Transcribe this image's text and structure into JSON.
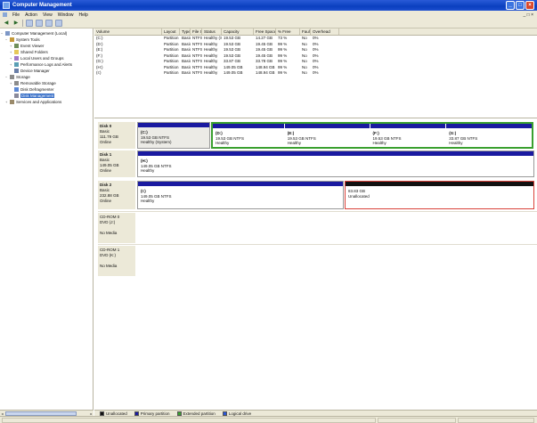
{
  "window": {
    "title": "Computer Management",
    "buttons": [
      "_",
      "□",
      "×"
    ]
  },
  "menubar": {
    "items": [
      "File",
      "Action",
      "View",
      "Window",
      "Help"
    ],
    "sys_label": "_ □ ×"
  },
  "toolbar": {
    "icons": [
      "back-icon",
      "forward-icon",
      "up-icon",
      "show-hide-tree-icon",
      "properties-icon",
      "help-icon"
    ]
  },
  "tree": {
    "items": [
      {
        "label": "Computer Management (Local)",
        "icon": "computer-icon",
        "depth": 0,
        "expander": "−"
      },
      {
        "label": "System Tools",
        "icon": "tools-icon",
        "depth": 1,
        "expander": "−"
      },
      {
        "label": "Event Viewer",
        "icon": "event-viewer-icon",
        "depth": 2,
        "expander": "+"
      },
      {
        "label": "Shared Folders",
        "icon": "folder-icon",
        "depth": 2,
        "expander": "+"
      },
      {
        "label": "Local Users and Groups",
        "icon": "users-icon",
        "depth": 2,
        "expander": "+"
      },
      {
        "label": "Performance Logs and Alerts",
        "icon": "performance-icon",
        "depth": 2,
        "expander": "+"
      },
      {
        "label": "Device Manager",
        "icon": "device-manager-icon",
        "depth": 2,
        "expander": ""
      },
      {
        "label": "Storage",
        "icon": "storage-icon",
        "depth": 1,
        "expander": "−"
      },
      {
        "label": "Removable Storage",
        "icon": "removable-storage-icon",
        "depth": 2,
        "expander": "+"
      },
      {
        "label": "Disk Defragmenter",
        "icon": "defrag-icon",
        "depth": 2,
        "expander": ""
      },
      {
        "label": "Disk Management",
        "icon": "disk-management-icon",
        "depth": 2,
        "expander": "",
        "selected": true
      },
      {
        "label": "Services and Applications",
        "icon": "services-icon",
        "depth": 1,
        "expander": "+"
      }
    ]
  },
  "volume_list": {
    "columns": [
      "Volume",
      "Layout",
      "Type",
      "File System",
      "Status",
      "Capacity",
      "Free Space",
      "% Free",
      "Fault Tolerance",
      "Overhead"
    ],
    "rows": [
      [
        "(C:)",
        "Partition",
        "Basic",
        "NTFS",
        "Healthy (System)",
        "19.53 GB",
        "14.27 GB",
        "73 %",
        "No",
        "0%"
      ],
      [
        "(D:)",
        "Partition",
        "Basic",
        "NTFS",
        "Healthy",
        "19.53 GB",
        "19.45 GB",
        "99 %",
        "No",
        "0%"
      ],
      [
        "(E:)",
        "Partition",
        "Basic",
        "NTFS",
        "Healthy",
        "19.53 GB",
        "19.45 GB",
        "99 %",
        "No",
        "0%"
      ],
      [
        "(F:)",
        "Partition",
        "Basic",
        "NTFS",
        "Healthy",
        "19.53 GB",
        "19.45 GB",
        "99 %",
        "No",
        "0%"
      ],
      [
        "(G:)",
        "Partition",
        "Basic",
        "NTFS",
        "Healthy",
        "33.87 GB",
        "33.78 GB",
        "99 %",
        "No",
        "0%"
      ],
      [
        "(H:)",
        "Partition",
        "Basic",
        "NTFS",
        "Healthy",
        "149.05 GB",
        "148.94 GB",
        "99 %",
        "No",
        "0%"
      ],
      [
        "(I:)",
        "Partition",
        "Basic",
        "NTFS",
        "Healthy",
        "149.05 GB",
        "148.94 GB",
        "99 %",
        "No",
        "0%"
      ]
    ]
  },
  "disks": [
    {
      "name": "Disk 0",
      "type": "Basic",
      "size": "111.79 GB",
      "status": "Online",
      "primary": {
        "name": "(C:)",
        "size": "19.53 GB NTFS",
        "status": "Healthy (System)"
      },
      "logicals": [
        {
          "name": "(D:)",
          "size": "19.53 GB NTFS",
          "status": "Healthy"
        },
        {
          "name": "(E:)",
          "size": "19.53 GB NTFS",
          "status": "Healthy"
        },
        {
          "name": "(F:)",
          "size": "19.53 GB NTFS",
          "status": "Healthy"
        },
        {
          "name": "(G:)",
          "size": "33.87 GB NTFS",
          "status": "Healthy"
        }
      ]
    },
    {
      "name": "Disk 1",
      "type": "Basic",
      "size": "149.05 GB",
      "status": "Online",
      "partitions": [
        {
          "name": "(H:)",
          "size": "149.05 GB NTFS",
          "status": "Healthy"
        }
      ]
    },
    {
      "name": "Disk 2",
      "type": "Basic",
      "size": "232.88 GB",
      "status": "Online",
      "partitions": [
        {
          "name": "(I:)",
          "size": "149.05 GB NTFS",
          "status": "Healthy"
        }
      ],
      "unallocated": {
        "size": "83.83 GB",
        "label": "Unallocated"
      }
    }
  ],
  "cdroms": [
    {
      "name": "CD-ROM 0",
      "drive": "DVD (J:)",
      "media": "No Media"
    },
    {
      "name": "CD-ROM 1",
      "drive": "DVD (K:)",
      "media": "No Media"
    }
  ],
  "legend": [
    {
      "label": "Unallocated",
      "color": "#111111"
    },
    {
      "label": "Primary partition",
      "color": "#1a1aa0"
    },
    {
      "label": "Extended partition",
      "color": "#3aa02f"
    },
    {
      "label": "Logical drive",
      "color": "#2a56d8"
    }
  ],
  "colors": {
    "title_bar": "#0a3fbf",
    "primary_partition": "#1a1aa0",
    "extended_partition": "#3aa02f",
    "unallocated": "#111111",
    "selection": "#316ac5"
  }
}
